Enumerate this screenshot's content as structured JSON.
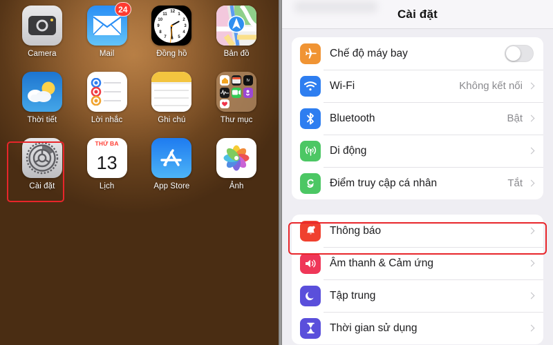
{
  "home_screen": {
    "name": "iPad home screen",
    "rows": [
      [
        {
          "label": "Camera",
          "icon": "camera-icon",
          "badge": null
        },
        {
          "label": "Mail",
          "icon": "mail-icon",
          "badge": "24"
        },
        {
          "label": "Đồng hồ",
          "icon": "clock-icon",
          "badge": null
        },
        {
          "label": "Bản đồ",
          "icon": "maps-icon",
          "badge": null
        }
      ],
      [
        {
          "label": "Thời tiết",
          "icon": "weather-icon",
          "badge": null
        },
        {
          "label": "Lời nhắc",
          "icon": "reminders-icon",
          "badge": null
        },
        {
          "label": "Ghi chú",
          "icon": "notes-icon",
          "badge": null
        },
        {
          "label": "Thư mục",
          "icon": "folder-icon",
          "badge": null
        }
      ],
      [
        {
          "label": "Cài đặt",
          "icon": "settings-gear-icon",
          "badge": null,
          "highlighted": true
        },
        {
          "label": "Lịch",
          "icon": "calendar-icon",
          "badge": null
        },
        {
          "label": "App Store",
          "icon": "app-store-icon",
          "badge": null
        },
        {
          "label": "Ảnh",
          "icon": "photos-icon",
          "badge": null
        }
      ]
    ],
    "calendar_icon": {
      "weekday": "THỨ BA",
      "day": "13"
    },
    "clock_icon_numbers": [
      "12",
      "1",
      "2",
      "3",
      "4",
      "5",
      "6",
      "7",
      "8",
      "9",
      "10",
      "11"
    ]
  },
  "settings": {
    "nav_title": "Cài đặt",
    "group_1": [
      {
        "label": "Chế độ máy bay",
        "icon": "airplane-icon",
        "icon_color": "#f09434",
        "control": "toggle",
        "toggle_on": false,
        "value": ""
      },
      {
        "label": "Wi-Fi",
        "icon": "wifi-icon",
        "icon_color": "#2e7ef0",
        "control": "chevron",
        "value": "Không kết nối"
      },
      {
        "label": "Bluetooth",
        "icon": "bluetooth-icon",
        "icon_color": "#2e7ef0",
        "control": "chevron",
        "value": "Bật"
      },
      {
        "label": "Di động",
        "icon": "cellular-icon",
        "icon_color": "#4cc764",
        "control": "chevron",
        "value": ""
      },
      {
        "label": "Điểm truy cập cá nhân",
        "icon": "hotspot-icon",
        "icon_color": "#4cc764",
        "control": "chevron",
        "value": "Tắt"
      }
    ],
    "group_2": [
      {
        "label": "Thông báo",
        "icon": "bell-icon",
        "icon_color": "#f0412f",
        "control": "chevron",
        "value": "",
        "highlighted": true
      },
      {
        "label": "Âm thanh & Cảm ứng",
        "icon": "speaker-icon",
        "icon_color": "#ef3758",
        "control": "chevron",
        "value": ""
      },
      {
        "label": "Tập trung",
        "icon": "moon-icon",
        "icon_color": "#5a4fdb",
        "control": "chevron",
        "value": ""
      },
      {
        "label": "Thời gian sử dụng",
        "icon": "hourglass-icon",
        "icon_color": "#5a4fdb",
        "control": "chevron",
        "value": ""
      }
    ]
  },
  "annotations": {
    "highlight_color": "#e8252a",
    "highlighted_app": "Cài đặt",
    "highlighted_setting_row": "Thông báo"
  }
}
